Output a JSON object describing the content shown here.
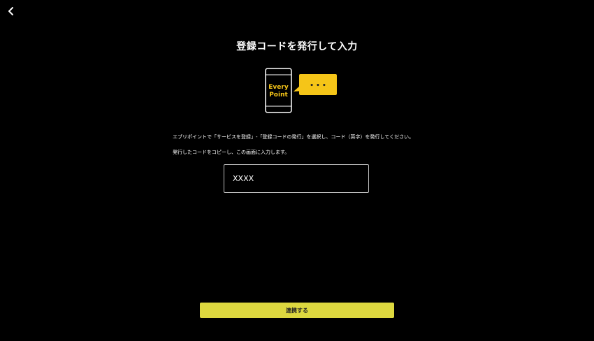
{
  "header": {
    "back_icon": "chevron-left-icon",
    "title": "登録コードを発行して入力"
  },
  "illustration": {
    "phone_text_line1": "Every",
    "phone_text_line2": "Point",
    "bubble_text": "• • •",
    "accent_color": "#f5c518"
  },
  "instructions": {
    "line1": "エブリポイントで「サービスを登録」-「登録コードの発行」を選択し、コード（英字）を発行してください。",
    "line2": "発行したコードをコピーし、この画面に入力します。"
  },
  "code_input": {
    "value": "",
    "placeholder": "XXXX"
  },
  "actions": {
    "link_label": "連携する",
    "link_color": "#ddd83f"
  }
}
